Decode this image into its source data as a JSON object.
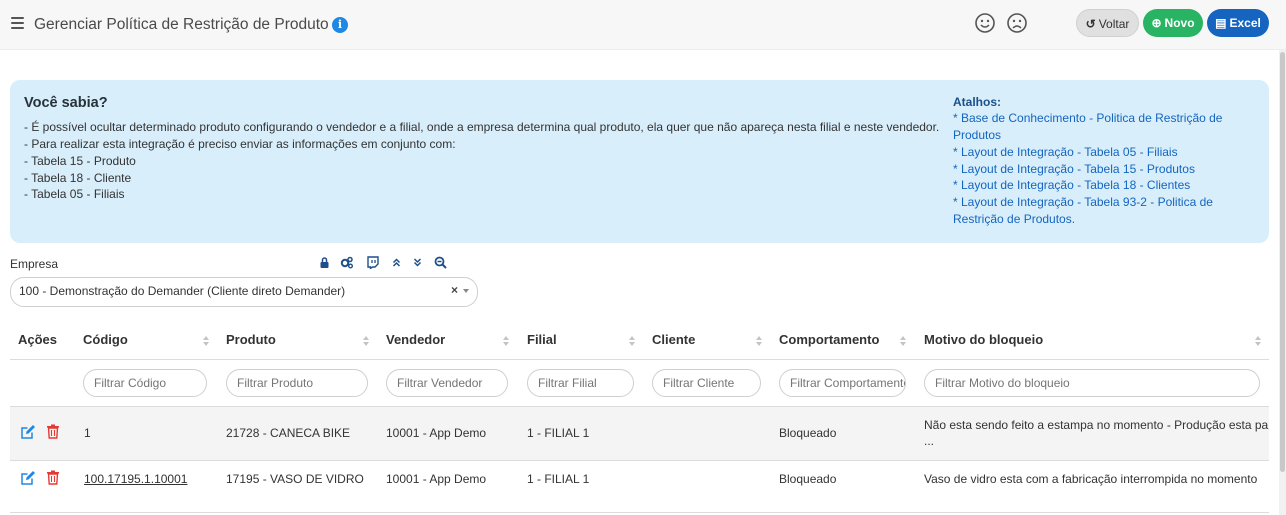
{
  "header": {
    "title": "Gerenciar Política de Restrição de Produto",
    "buttons": {
      "voltar": "Voltar",
      "novo": "Novo",
      "excel": "Excel"
    }
  },
  "info": {
    "heading": "Você sabia?",
    "lines": [
      "- É possível ocultar determinado produto configurando o vendedor e a filial, onde a empresa determina qual produto, ela quer que não apareça nesta filial e neste vendedor.",
      "- Para realizar esta integração é preciso enviar as informações em conjunto com:",
      "- Tabela 15 - Produto",
      "- Tabela 18 - Cliente",
      "- Tabela 05 - Filiais"
    ],
    "shortcuts_title": "Atalhos:",
    "shortcuts": [
      "* Base de Conhecimento - Politica de Restrição de Produtos",
      "* Layout de Integração - Tabela 05 - Filiais",
      "* Layout de Integração - Tabela 15 - Produtos",
      "* Layout de Integração - Tabela 18 - Clientes",
      "* Layout de Integração - Tabela 93-2 - Politica de Restrição de Produtos."
    ]
  },
  "empresa": {
    "label": "Empresa",
    "selected": "100 - Demonstração do Demander (Cliente direto Demander)",
    "clear": "×"
  },
  "table": {
    "headers": [
      "Ações",
      "Código",
      "Produto",
      "Vendedor",
      "Filial",
      "Cliente",
      "Comportamento",
      "Motivo do bloqueio"
    ],
    "filters": [
      "Filtrar Código",
      "Filtrar Produto",
      "Filtrar Vendedor",
      "Filtrar Filial",
      "Filtrar Cliente",
      "Filtrar Comportamento",
      "Filtrar Motivo do bloqueio"
    ],
    "rows": [
      {
        "codigo": "1",
        "produto": "21728 - CANECA BIKE",
        "vendedor": "10001 - App Demo",
        "filial": "1 - FILIAL 1",
        "cliente": "",
        "comportamento": "Bloqueado",
        "motivo": "Não esta sendo feito a estampa no momento - Produção esta pa",
        "motivo_more": "..."
      },
      {
        "codigo": "100.17195.1.10001",
        "produto": "17195 - VASO DE VIDRO",
        "vendedor": "10001 - App Demo",
        "filial": "1 - FILIAL 1",
        "cliente": "",
        "comportamento": "Bloqueado",
        "motivo": "Vaso de vidro esta com a fabricação interrompida no momento",
        "motivo_more": ""
      }
    ]
  },
  "colors": {
    "novo": "#28b463",
    "excel": "#1565c0",
    "info_bg": "#d8eefb",
    "link": "#1565c0",
    "edit": "#1e88e5",
    "delete": "#e53935"
  }
}
